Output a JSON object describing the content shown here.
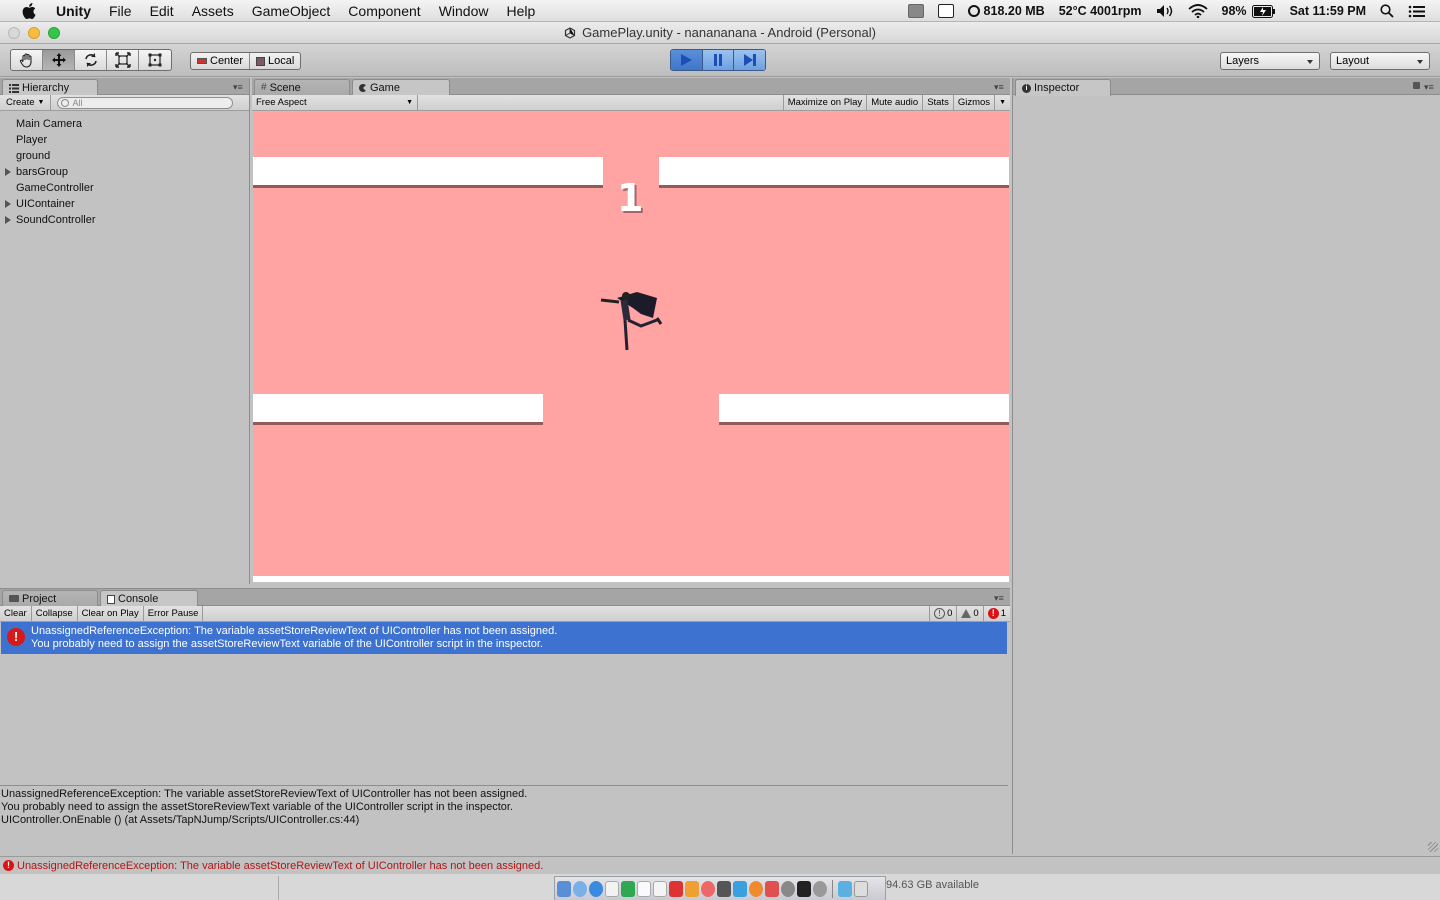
{
  "menubar": {
    "app_name": "Unity",
    "menus": [
      "File",
      "Edit",
      "Assets",
      "GameObject",
      "Component",
      "Window",
      "Help"
    ],
    "memory": "818.20 MB",
    "temp": "52°C 4001rpm",
    "battery": "98%",
    "clock": "Sat 11:59 PM"
  },
  "window": {
    "title": "GamePlay.unity - nanananana - Android (Personal)"
  },
  "toolbar": {
    "pivot_center": "Center",
    "pivot_local": "Local",
    "layers_label": "Layers",
    "layout_label": "Layout"
  },
  "hierarchy": {
    "tab_label": "Hierarchy",
    "create_label": "Create",
    "search_placeholder": "All",
    "items": [
      {
        "label": "Main Camera",
        "expandable": false
      },
      {
        "label": "Player",
        "expandable": false
      },
      {
        "label": "ground",
        "expandable": false
      },
      {
        "label": "barsGroup",
        "expandable": true
      },
      {
        "label": "GameController",
        "expandable": false
      },
      {
        "label": "UIContainer",
        "expandable": true
      },
      {
        "label": "SoundController",
        "expandable": true
      }
    ]
  },
  "gameview": {
    "scene_tab": "Scene",
    "game_tab": "Game",
    "aspect": "Free Aspect",
    "maximize": "Maximize on Play",
    "mute": "Mute audio",
    "stats": "Stats",
    "gizmos": "Gizmos",
    "score": "1",
    "background_color": "#ffa3a3"
  },
  "inspector": {
    "tab_label": "Inspector"
  },
  "console": {
    "project_tab": "Project",
    "console_tab": "Console",
    "clear": "Clear",
    "collapse": "Collapse",
    "clear_on_play": "Clear on Play",
    "error_pause": "Error Pause",
    "info_count": "0",
    "warning_count": "0",
    "error_count": "1",
    "entry_line1": "UnassignedReferenceException: The variable assetStoreReviewText of UIController has not been assigned.",
    "entry_line2": "You probably need to assign the assetStoreReviewText variable of the UIController script in the inspector.",
    "detail_line1": "UnassignedReferenceException: The variable assetStoreReviewText of UIController has not been assigned.",
    "detail_line2": "You probably need to assign the assetStoreReviewText variable of the UIController script in the inspector.",
    "detail_line3": "UIController.OnEnable () (at Assets/TapNJump/Scripts/UIController.cs:44)",
    "selection_color": "#3d72d0"
  },
  "statusbar": {
    "message": "UnassignedReferenceException: The variable assetStoreReviewText of UIController has not been assigned."
  },
  "dock": {
    "disk_space": "94.63 GB available"
  }
}
